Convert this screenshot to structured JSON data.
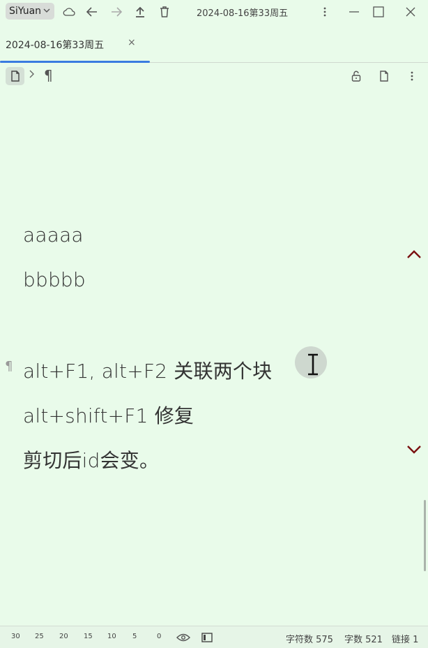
{
  "titlebar": {
    "workspace": "SiYuan",
    "title": "2024-08-16第33周五",
    "icons": [
      "chevron-down-icon",
      "cloud-icon",
      "back-arrow-icon",
      "forward-arrow-icon",
      "upload-icon",
      "trash-icon",
      "more-vertical-icon",
      "minimize-icon",
      "maximize-icon",
      "close-icon"
    ]
  },
  "tab": {
    "label": "2024-08-16第33周五",
    "close": "×"
  },
  "breadcrumb": {
    "para_symbol": "¶",
    "icons": [
      "document-icon",
      "chevron-right-icon",
      "unlock-icon",
      "document-icon",
      "more-vertical-icon"
    ]
  },
  "editor": {
    "lines": [
      "aaaaa",
      "bbbbb",
      "alt+F1, alt+F2 关联两个块",
      "alt+shift+F1 修复",
      "剪切后id会变。"
    ],
    "gutter_mark": "¶"
  },
  "statusbar": {
    "zoom_levels": [
      "30",
      "25",
      "20",
      "15",
      "10",
      "5",
      "0"
    ],
    "char_count": "字符数 575",
    "word_count": "字数 521",
    "link_count": "链接 1"
  },
  "colors": {
    "background": "#e9fbea",
    "accent": "#3a7be0",
    "nav_arrow": "#7a1010"
  }
}
